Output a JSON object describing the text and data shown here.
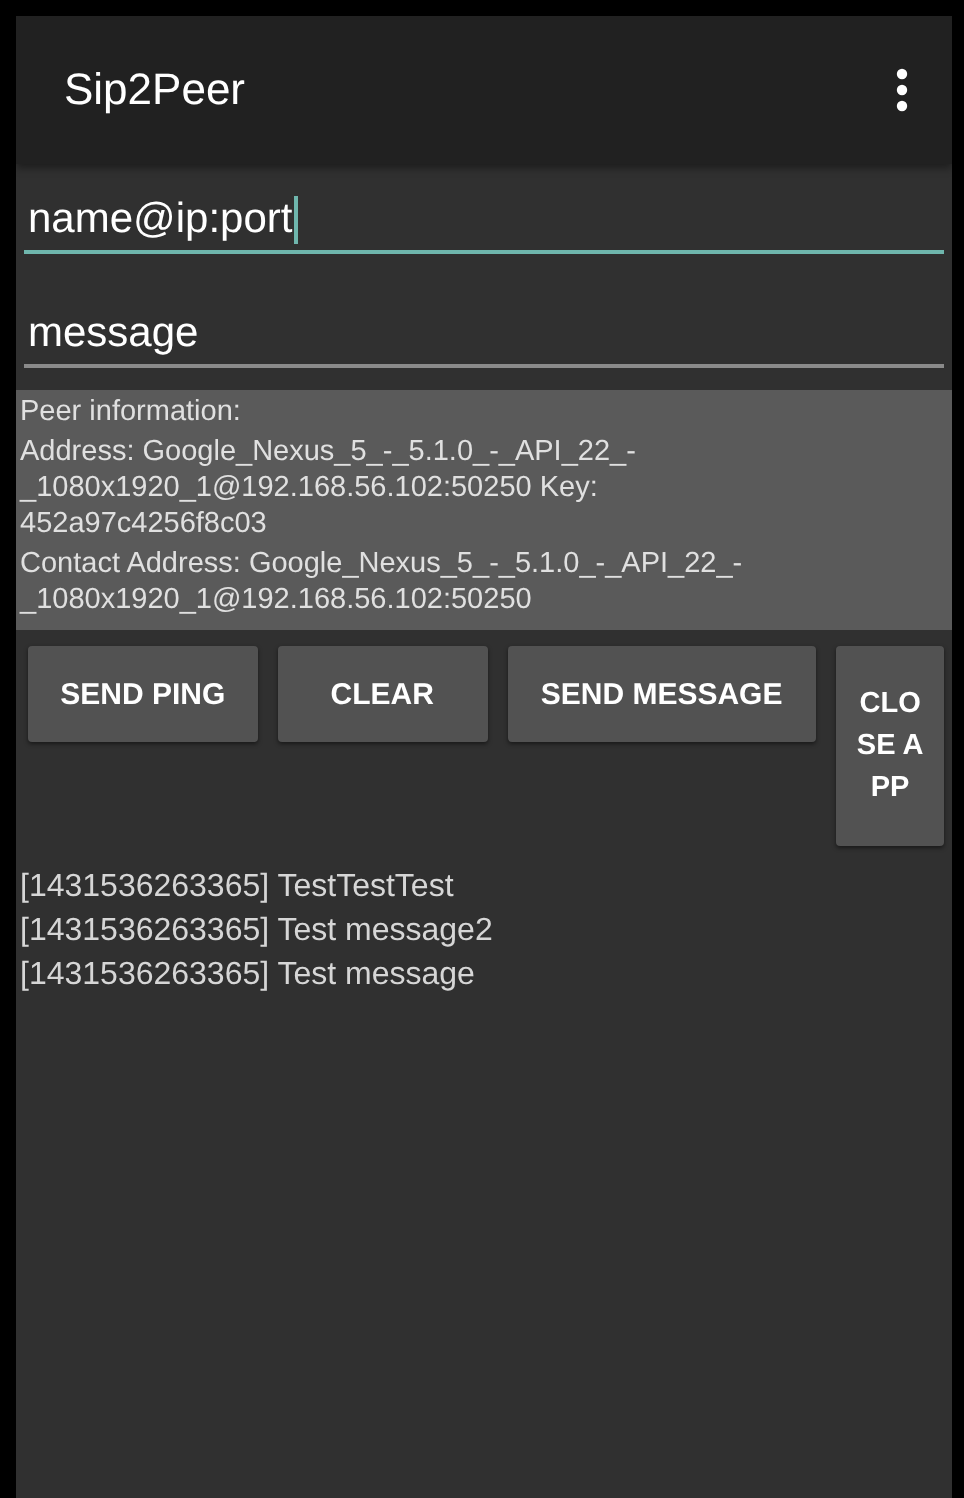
{
  "app_bar": {
    "title": "Sip2Peer"
  },
  "fields": [
    {
      "value": "name@ip:port",
      "focused": true
    },
    {
      "value": "message",
      "focused": false
    }
  ],
  "peer_info": [
    "Peer information:",
    "Address: Google_Nexus_5_-_5.1.0_-_API_22_-\n_1080x1920_1@192.168.56.102:50250 Key:\n452a97c4256f8c03",
    "Contact Address: Google_Nexus_5_-_5.1.0_-_API_22_-\n_1080x1920_1@192.168.56.102:50250"
  ],
  "buttons": [
    {
      "label": "SEND PING",
      "kind": "normal"
    },
    {
      "label": "CLEAR",
      "kind": "normal"
    },
    {
      "label": "SEND MESSAGE",
      "kind": "normal"
    },
    {
      "label": "CLOSE APP",
      "kind": "narrow"
    }
  ],
  "log": [
    "[1431536263365] TestTestTest",
    "[1431536263365] Test message2",
    "[1431536263365] Test message"
  ]
}
